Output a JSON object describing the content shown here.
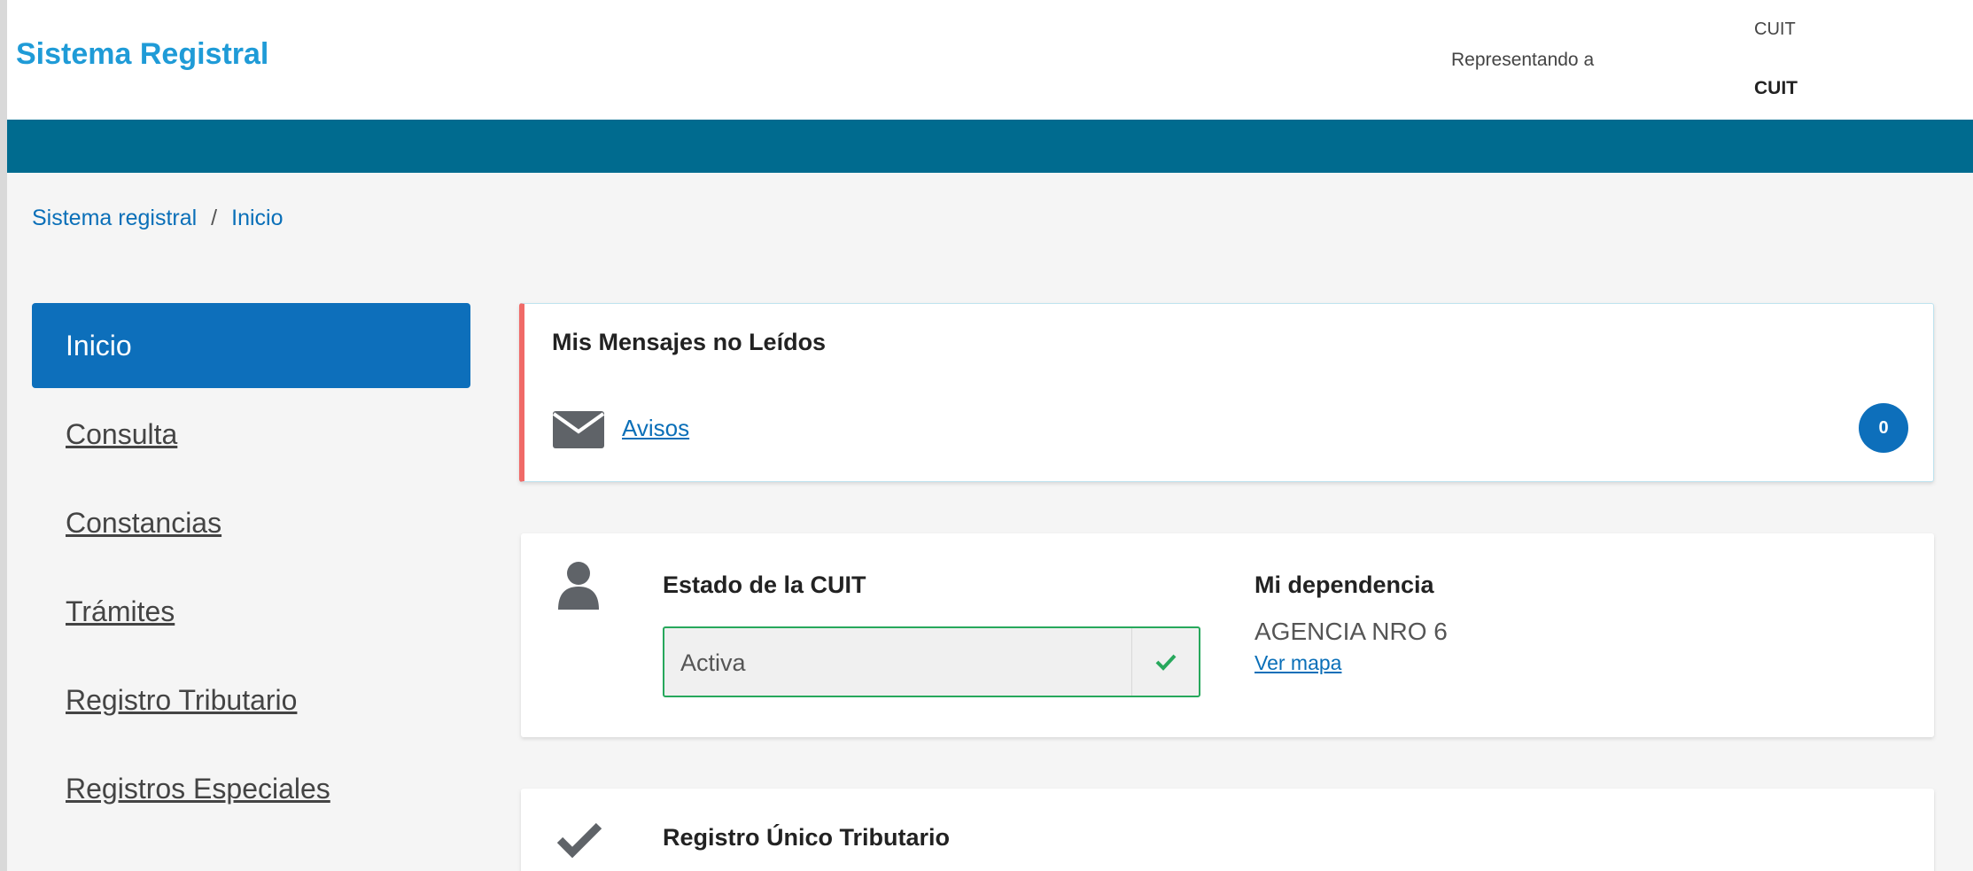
{
  "header": {
    "brand": "Sistema Registral",
    "representing_label": "Representando a",
    "cuit_label_top": "CUIT",
    "cuit_label_bottom": "CUIT"
  },
  "breadcrumb": {
    "items": [
      "Sistema registral",
      "Inicio"
    ],
    "separator": "/"
  },
  "sidebar": {
    "items": [
      {
        "label": "Inicio",
        "active": true
      },
      {
        "label": "Consulta"
      },
      {
        "label": "Constancias"
      },
      {
        "label": "Trámites"
      },
      {
        "label": "Registro Tributario"
      },
      {
        "label": "Registros Especiales"
      }
    ]
  },
  "messages_card": {
    "title": "Mis Mensajes no Leídos",
    "link": "Avisos",
    "count": "0",
    "icon": "envelope-icon"
  },
  "status_card": {
    "title": "Estado de la CUIT",
    "value": "Activa",
    "dependency_title": "Mi dependencia",
    "dependency_value": "AGENCIA NRO 6",
    "map_link": "Ver mapa",
    "icon": "user-icon"
  },
  "rut_card": {
    "title": "Registro Único Tributario",
    "icon": "check-icon"
  },
  "colors": {
    "brand": "#1f9bd7",
    "bluebar": "#006b8f",
    "primary": "#0d6fbb",
    "link": "#0a6fb8",
    "alert_border": "#f06a67",
    "success": "#27a85c"
  }
}
